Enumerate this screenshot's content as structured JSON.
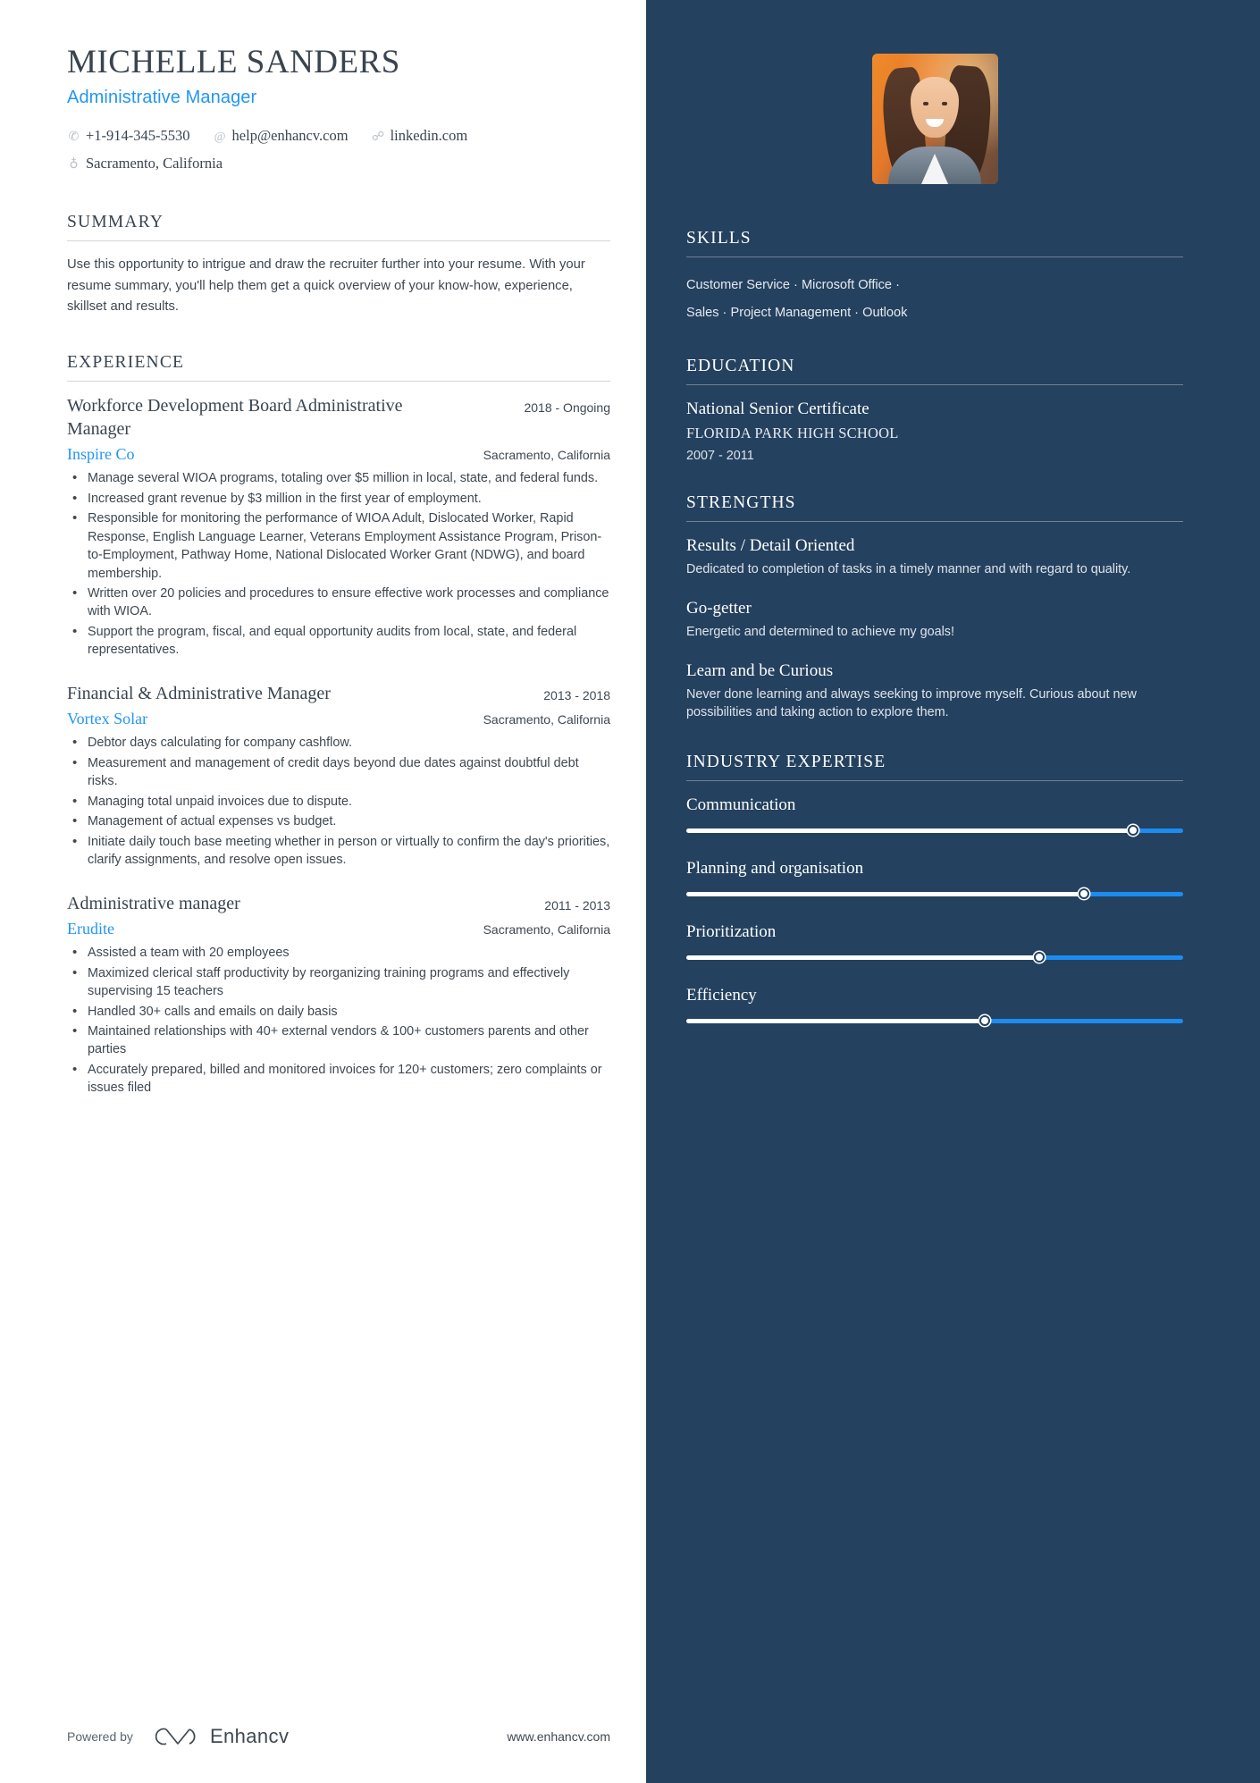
{
  "header": {
    "name": "MICHELLE SANDERS",
    "job_title": "Administrative Manager",
    "contacts": [
      {
        "icon": "phone-icon",
        "glyph": "✆",
        "text": "+1-914-345-5530"
      },
      {
        "icon": "email-icon",
        "glyph": "@",
        "text": "help@enhancv.com"
      },
      {
        "icon": "link-icon",
        "glyph": "☍",
        "text": "linkedin.com"
      },
      {
        "icon": "location-pin-icon",
        "glyph": "♁",
        "text": "Sacramento, California"
      }
    ]
  },
  "summary": {
    "title": "SUMMARY",
    "text": "Use this opportunity to intrigue and draw the recruiter further into your resume. With your resume summary, you'll help them get a quick overview of your know-how, experience, skillset and results."
  },
  "experience": {
    "title": "EXPERIENCE",
    "jobs": [
      {
        "role": "Workforce Development Board Administrative Manager",
        "dates": "2018 - Ongoing",
        "company": "Inspire Co",
        "location": "Sacramento, California",
        "bullets": [
          "Manage several WIOA programs, totaling over $5 million in local, state, and federal funds.",
          "Increased grant revenue by $3 million in the first year of employment.",
          "Responsible for monitoring the performance of WIOA Adult, Dislocated Worker, Rapid Response, English Language Learner, Veterans Employment Assistance Program, Prison-to-Employment, Pathway Home, National Dislocated Worker Grant (NDWG), and board membership.",
          "Written over 20 policies and procedures to ensure effective work processes and compliance with WIOA.",
          "Support the program, fiscal, and equal opportunity audits from local, state, and federal representatives."
        ]
      },
      {
        "role": "Financial & Administrative Manager",
        "dates": "2013 - 2018",
        "company": "Vortex Solar",
        "location": "Sacramento, California",
        "bullets": [
          "Debtor days calculating for company cashflow.",
          "Measurement and management of credit days beyond due dates against doubtful debt risks.",
          "Managing total unpaid invoices due to dispute.",
          "Management of actual expenses vs budget.",
          "Initiate daily touch base meeting whether in person or virtually to confirm the day's priorities, clarify assignments, and resolve open issues."
        ]
      },
      {
        "role": "Administrative manager",
        "dates": "2011 - 2013",
        "company": "Erudite",
        "location": "Sacramento, California",
        "bullets": [
          "Assisted a team with 20 employees",
          "Maximized clerical staff productivity by reorganizing training programs and effectively supervising 15 teachers",
          "Handled 30+ calls and emails on daily basis",
          "Maintained relationships with 40+ external vendors & 100+ customers parents and other parties",
          "Accurately prepared, billed and monitored invoices for 120+ customers; zero complaints or issues filed"
        ]
      }
    ]
  },
  "footer": {
    "powered_by": "Powered by",
    "brand": "Enhancv",
    "url": "www.enhancv.com"
  },
  "sidebar": {
    "photo": {
      "alt": "profile-photo"
    },
    "skills": {
      "title": "SKILLS",
      "lines": [
        "Customer Service · Microsoft Office ·",
        "Sales · Project Management · Outlook"
      ]
    },
    "education": {
      "title": "EDUCATION",
      "degree": "National Senior Certificate",
      "school": "FLORIDA PARK HIGH SCHOOL",
      "years": "2007 - 2011"
    },
    "strengths": {
      "title": "STRENGTHS",
      "items": [
        {
          "title": "Results / Detail Oriented",
          "desc": "Dedicated to completion of tasks in a timely manner and with regard to quality."
        },
        {
          "title": "Go-getter",
          "desc": "Energetic and determined to achieve my goals!"
        },
        {
          "title": "Learn and be Curious",
          "desc": "Never done learning and always seeking to improve myself. Curious about new possibilities and taking action to explore them."
        }
      ]
    },
    "expertise": {
      "title": "INDUSTRY EXPERTISE",
      "items": [
        {
          "label": "Communication",
          "value": 90
        },
        {
          "label": "Planning and organisation",
          "value": 80
        },
        {
          "label": "Prioritization",
          "value": 71
        },
        {
          "label": "Efficiency",
          "value": 60
        }
      ]
    }
  },
  "colors": {
    "sidebar_bg": "#24415f",
    "accent_blue": "#2196f3",
    "slider_fill": "#1d8cf0",
    "text_dark": "#3a444f"
  }
}
